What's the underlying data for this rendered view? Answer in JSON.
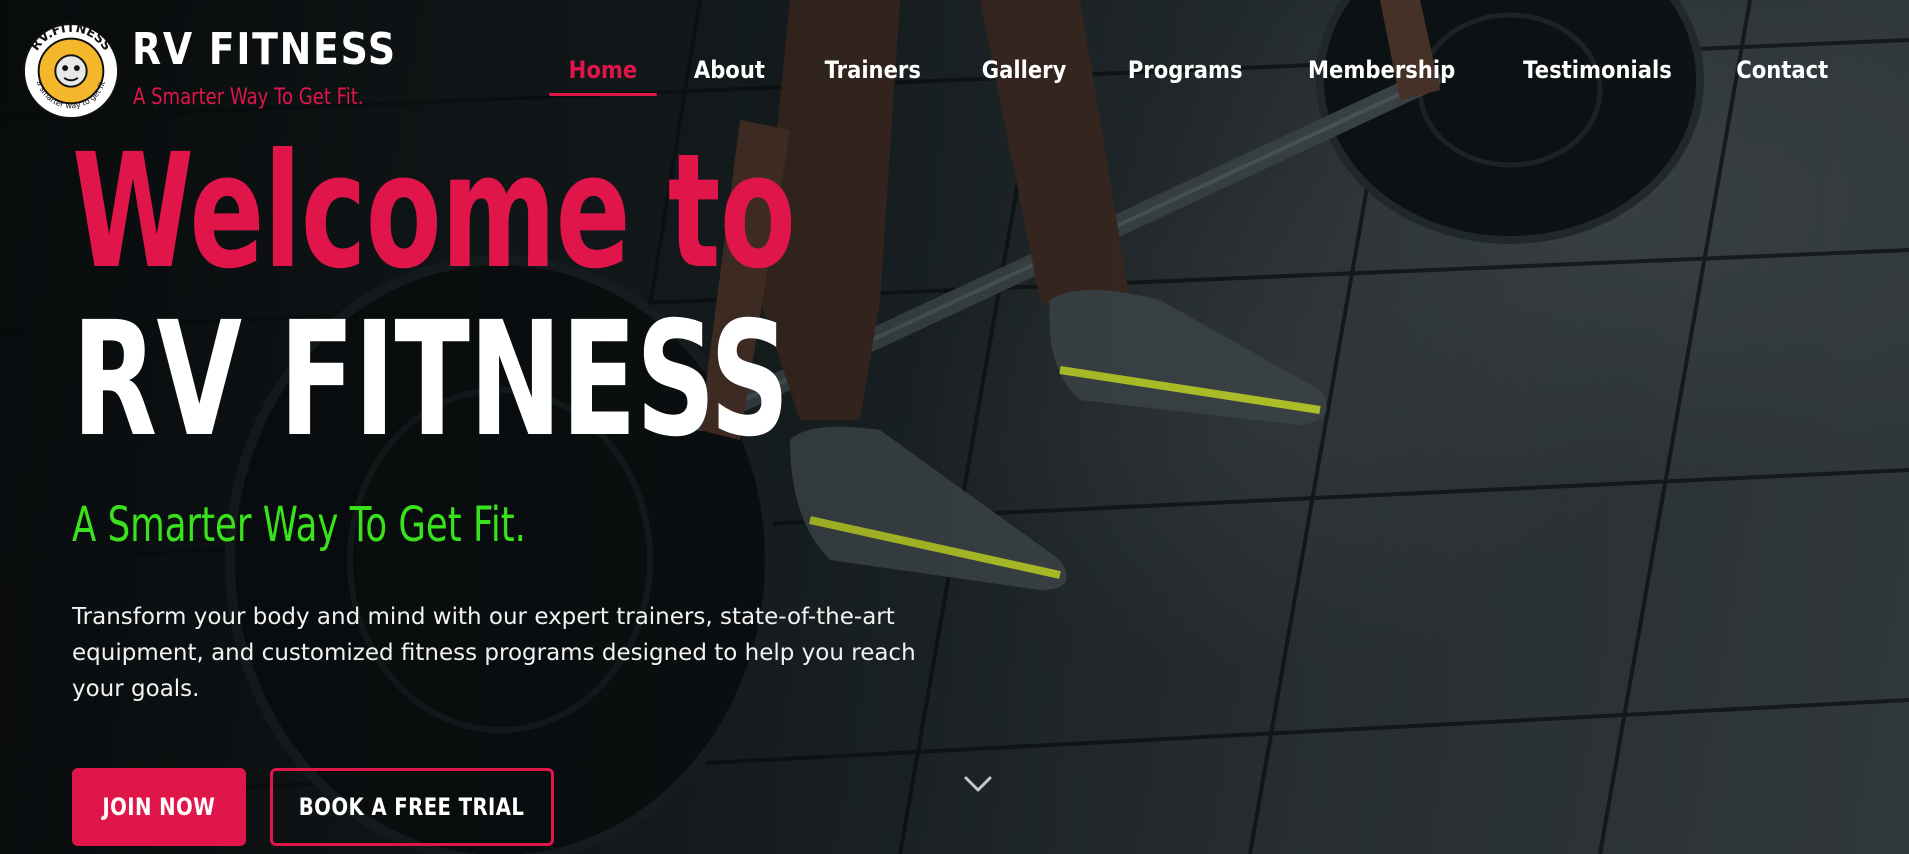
{
  "brand": {
    "name": "RV FITNESS",
    "tagline": "A Smarter Way To Get Fit.",
    "logo_text_top": "RV.FITNESS",
    "logo_text_bottom": "a smarter way to get fit",
    "colors": {
      "accent": "#e0164b",
      "green": "#39e21d",
      "logo_yellow": "#f4b62a"
    }
  },
  "nav": {
    "items": [
      {
        "label": "Home",
        "active": true
      },
      {
        "label": "About"
      },
      {
        "label": "Trainers"
      },
      {
        "label": "Gallery"
      },
      {
        "label": "Programs"
      },
      {
        "label": "Membership"
      },
      {
        "label": "Testimonials"
      },
      {
        "label": "Contact"
      }
    ]
  },
  "hero": {
    "title_line1": "Welcome to",
    "title_line2": "RV FITNESS",
    "tagline": "A Smarter Way To Get Fit.",
    "description": "Transform your body and mind with our expert trainers, state-of-the-art equipment, and customized fitness programs designed to help you reach your goals.",
    "primary_button": "JOIN NOW",
    "secondary_button": "BOOK A FREE TRIAL",
    "scroll_icon": "chevron-down-icon",
    "background_image": "deadlift-barbell-gym-floor"
  }
}
